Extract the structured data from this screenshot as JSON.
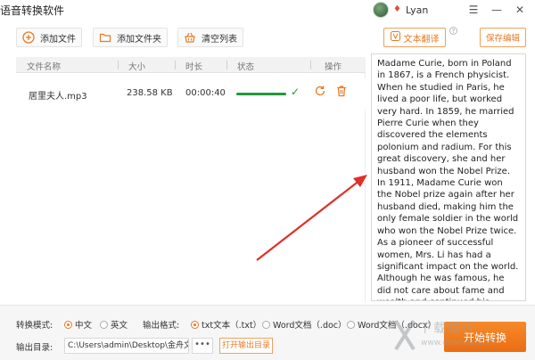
{
  "app": {
    "title": "语音转换软件",
    "username": "Lyan"
  },
  "toolbar": {
    "add_file": "添加文件",
    "add_folder": "添加文件夹",
    "clear_list": "清空列表"
  },
  "table": {
    "headers": [
      "文件名称",
      "大小",
      "时长",
      "状态",
      "操作"
    ],
    "rows": [
      {
        "name": "居里夫人.mp3",
        "size": "238.58 KB",
        "duration": "00:00:40",
        "progress": 1.0
      }
    ]
  },
  "right_panel": {
    "translate_label": "文本翻译",
    "save_label": "保存编辑",
    "text": "Madame Curie, born in Poland in 1867, is a French physicist. When he studied in Paris, he lived a poor life, but worked very hard. In 1859, he married Pierre Curie when they discovered the elements polonium and radium. For this great discovery, she and her husband won the Nobel Prize. In 1911, Madame Curie won the Nobel prize again after her husband died, making him the only female soldier in the world who won the Nobel Prize twice. As a pioneer of successful women, Mrs. Li has had a significant impact on the world. Although he was famous, he did not care about fame and wealth and continued his scientific research."
  },
  "bottom": {
    "mode_label": "转换模式:",
    "mode_options": [
      "中文",
      "英文"
    ],
    "mode_selected": 0,
    "format_label": "输出格式:",
    "format_options": [
      "txt文本（.txt）",
      "Word文档（.doc）",
      "Word文档（.docx）"
    ],
    "format_selected": 0,
    "output_label": "输出目录:",
    "output_path": "C:\\Users\\admin\\Desktop\\金舟文字",
    "browse_label": "•••",
    "open_dir_label": "打开输出目录",
    "start_label": "开始转换"
  },
  "watermark": {
    "line1": "下载银行",
    "line2": "www.downbank.cn"
  },
  "colors": {
    "accent": "#ec6d12",
    "success": "#1f9a3a",
    "arrow": "#e0302a"
  }
}
